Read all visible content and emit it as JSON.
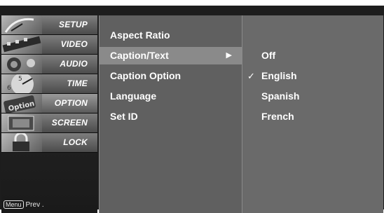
{
  "menu": {
    "items": [
      {
        "label": "SETUP",
        "icon": "satellite-dish-icon"
      },
      {
        "label": "VIDEO",
        "icon": "film-reel-icon"
      },
      {
        "label": "AUDIO",
        "icon": "speaker-icon"
      },
      {
        "label": "TIME",
        "icon": "clock-icon"
      },
      {
        "label": "OPTION",
        "icon": "option-badge-icon"
      },
      {
        "label": "SCREEN",
        "icon": "monitor-icon"
      },
      {
        "label": "LOCK",
        "icon": "padlock-icon"
      }
    ],
    "active_index": 4,
    "footer_key": "Menu",
    "footer_text": "Prev ."
  },
  "submenu": {
    "items": [
      {
        "label": "Aspect Ratio"
      },
      {
        "label": "Caption/Text",
        "arrow": "▶"
      },
      {
        "label": "Caption Option"
      },
      {
        "label": "Language"
      },
      {
        "label": "Set ID"
      }
    ],
    "selected_index": 1
  },
  "options": {
    "items": [
      {
        "label": "Off",
        "check": ""
      },
      {
        "label": "English",
        "check": "✓"
      },
      {
        "label": "Spanish",
        "check": ""
      },
      {
        "label": "French",
        "check": ""
      }
    ]
  },
  "colors": {
    "screen_bg": "#1d1d1d",
    "submenu_bg": "#606060",
    "highlight": "#8a8a8a",
    "options_bg": "#6a6a6a",
    "text": "#ffffff"
  }
}
